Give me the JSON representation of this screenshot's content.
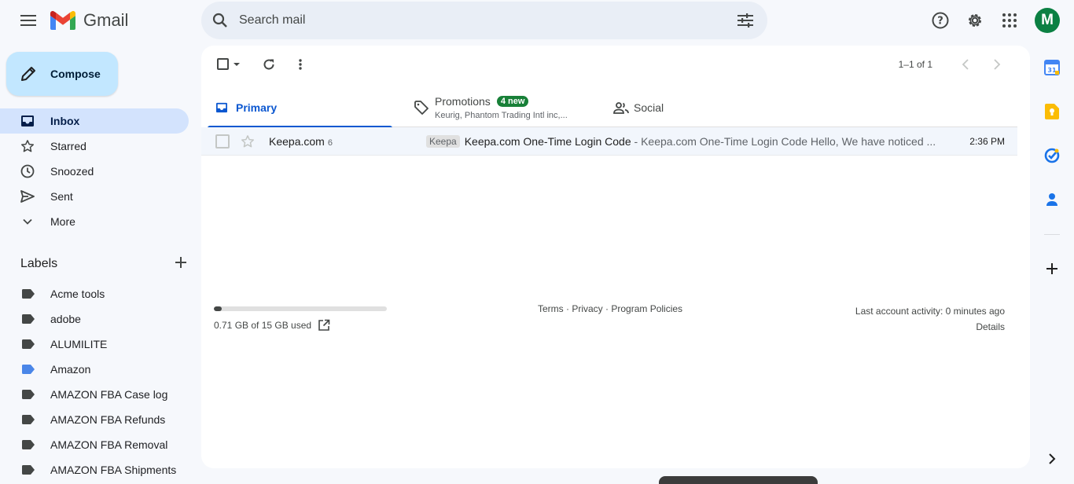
{
  "header": {
    "app_name": "Gmail",
    "search_placeholder": "Search mail",
    "avatar_letter": "M"
  },
  "compose": {
    "label": "Compose"
  },
  "nav": {
    "items": [
      {
        "label": "Inbox",
        "icon": "inbox-icon",
        "active": true
      },
      {
        "label": "Starred",
        "icon": "star-icon"
      },
      {
        "label": "Snoozed",
        "icon": "clock-icon"
      },
      {
        "label": "Sent",
        "icon": "send-icon"
      },
      {
        "label": "More",
        "icon": "chevron-down-icon"
      }
    ]
  },
  "labels": {
    "title": "Labels",
    "items": [
      {
        "name": "Acme tools",
        "color": "#444746"
      },
      {
        "name": "adobe",
        "color": "#444746"
      },
      {
        "name": "ALUMILITE",
        "color": "#444746"
      },
      {
        "name": "Amazon",
        "color": "#4a86e8"
      },
      {
        "name": "AMAZON FBA Case log",
        "color": "#444746"
      },
      {
        "name": "AMAZON FBA Refunds",
        "color": "#444746"
      },
      {
        "name": "AMAZON FBA Removal",
        "color": "#444746"
      },
      {
        "name": "AMAZON FBA Shipments",
        "color": "#444746"
      }
    ]
  },
  "toolbar": {
    "pagination": "1–1 of 1"
  },
  "tabs": {
    "primary": "Primary",
    "promotions": "Promotions",
    "promotions_badge": "4 new",
    "promotions_sub": "Keurig, Phantom Trading Intl inc,...",
    "social": "Social"
  },
  "emails": [
    {
      "sender": "Keepa.com",
      "count": "6",
      "label_chip": "Keepa",
      "subject": "Keepa.com One-Time Login Code",
      "snippet": " - Keepa.com One-Time Login Code Hello, We have noticed ...",
      "time": "2:36 PM"
    }
  ],
  "footer": {
    "storage_text": "0.71 GB of 15 GB used",
    "storage_fraction": 0.047,
    "terms": "Terms",
    "sep1": " · ",
    "privacy": "Privacy",
    "sep2": " · ",
    "policies": "Program Policies",
    "last_activity": "Last account activity: 0 minutes ago",
    "details": "Details"
  },
  "colors": {
    "accent": "#0b57d0",
    "compose_bg": "#c2e7ff",
    "active_nav": "#d3e3fd",
    "badge_green": "#188038",
    "avatar_bg": "#0b8043"
  }
}
